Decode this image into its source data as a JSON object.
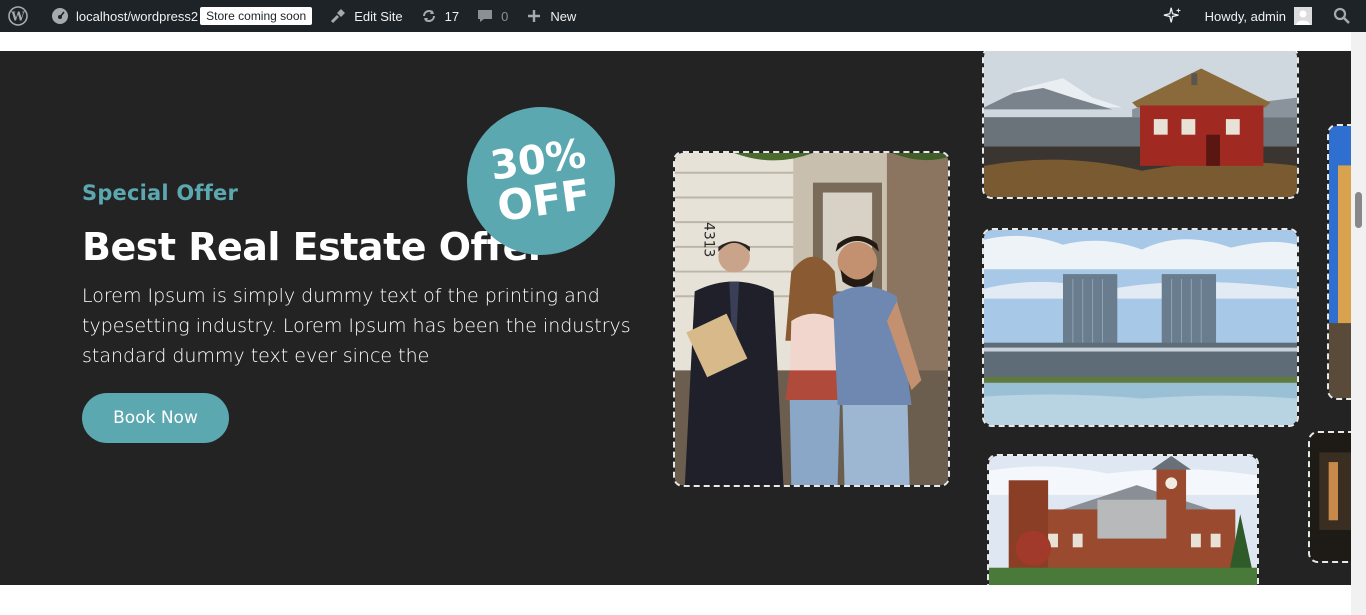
{
  "adminbar": {
    "wp_logo_icon": "wordpress-icon",
    "site_name": "localhost/wordpress2",
    "store_badge": "Store coming soon",
    "edit_site": "Edit Site",
    "updates_count": "17",
    "comments_count": "0",
    "new_label": "New",
    "greeting": "Howdy, admin"
  },
  "hero": {
    "eyebrow": "Special Offer",
    "title": "Best Real Estate Offer",
    "description": "Lorem Ipsum is simply dummy text of the printing and typesetting industry. Lorem Ipsum has been the industrys standard dummy text ever since the",
    "button_label": "Book Now",
    "badge_percent": "30%",
    "badge_off": "OFF"
  },
  "colors": {
    "accent": "#5ba8b0",
    "hero_bg": "#232324",
    "adminbar_bg": "#1d2327"
  }
}
